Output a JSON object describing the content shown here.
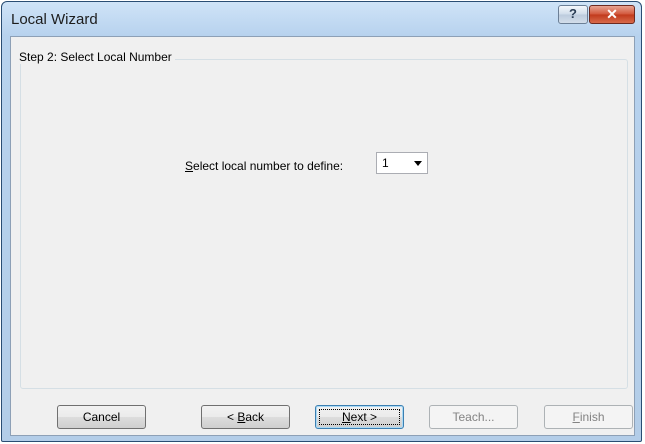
{
  "window": {
    "title": "Local Wizard",
    "help_glyph": "?",
    "close_glyph": "✕"
  },
  "group": {
    "legend": "Step 2: Select Local Number"
  },
  "form": {
    "label_accel": "S",
    "label_rest": "elect local number to define:",
    "combo_value": "1"
  },
  "buttons": {
    "cancel": "Cancel",
    "back_prefix": "< ",
    "back_accel": "B",
    "back_rest": "ack",
    "next_accel": "N",
    "next_rest": "ext >",
    "teach": "Teach...",
    "finish_accel": "F",
    "finish_rest": "inish"
  },
  "colors": {
    "title_gradient_top": "#cfe3f7",
    "close_red": "#c13a1c",
    "client_bg": "#f0f0f0"
  }
}
